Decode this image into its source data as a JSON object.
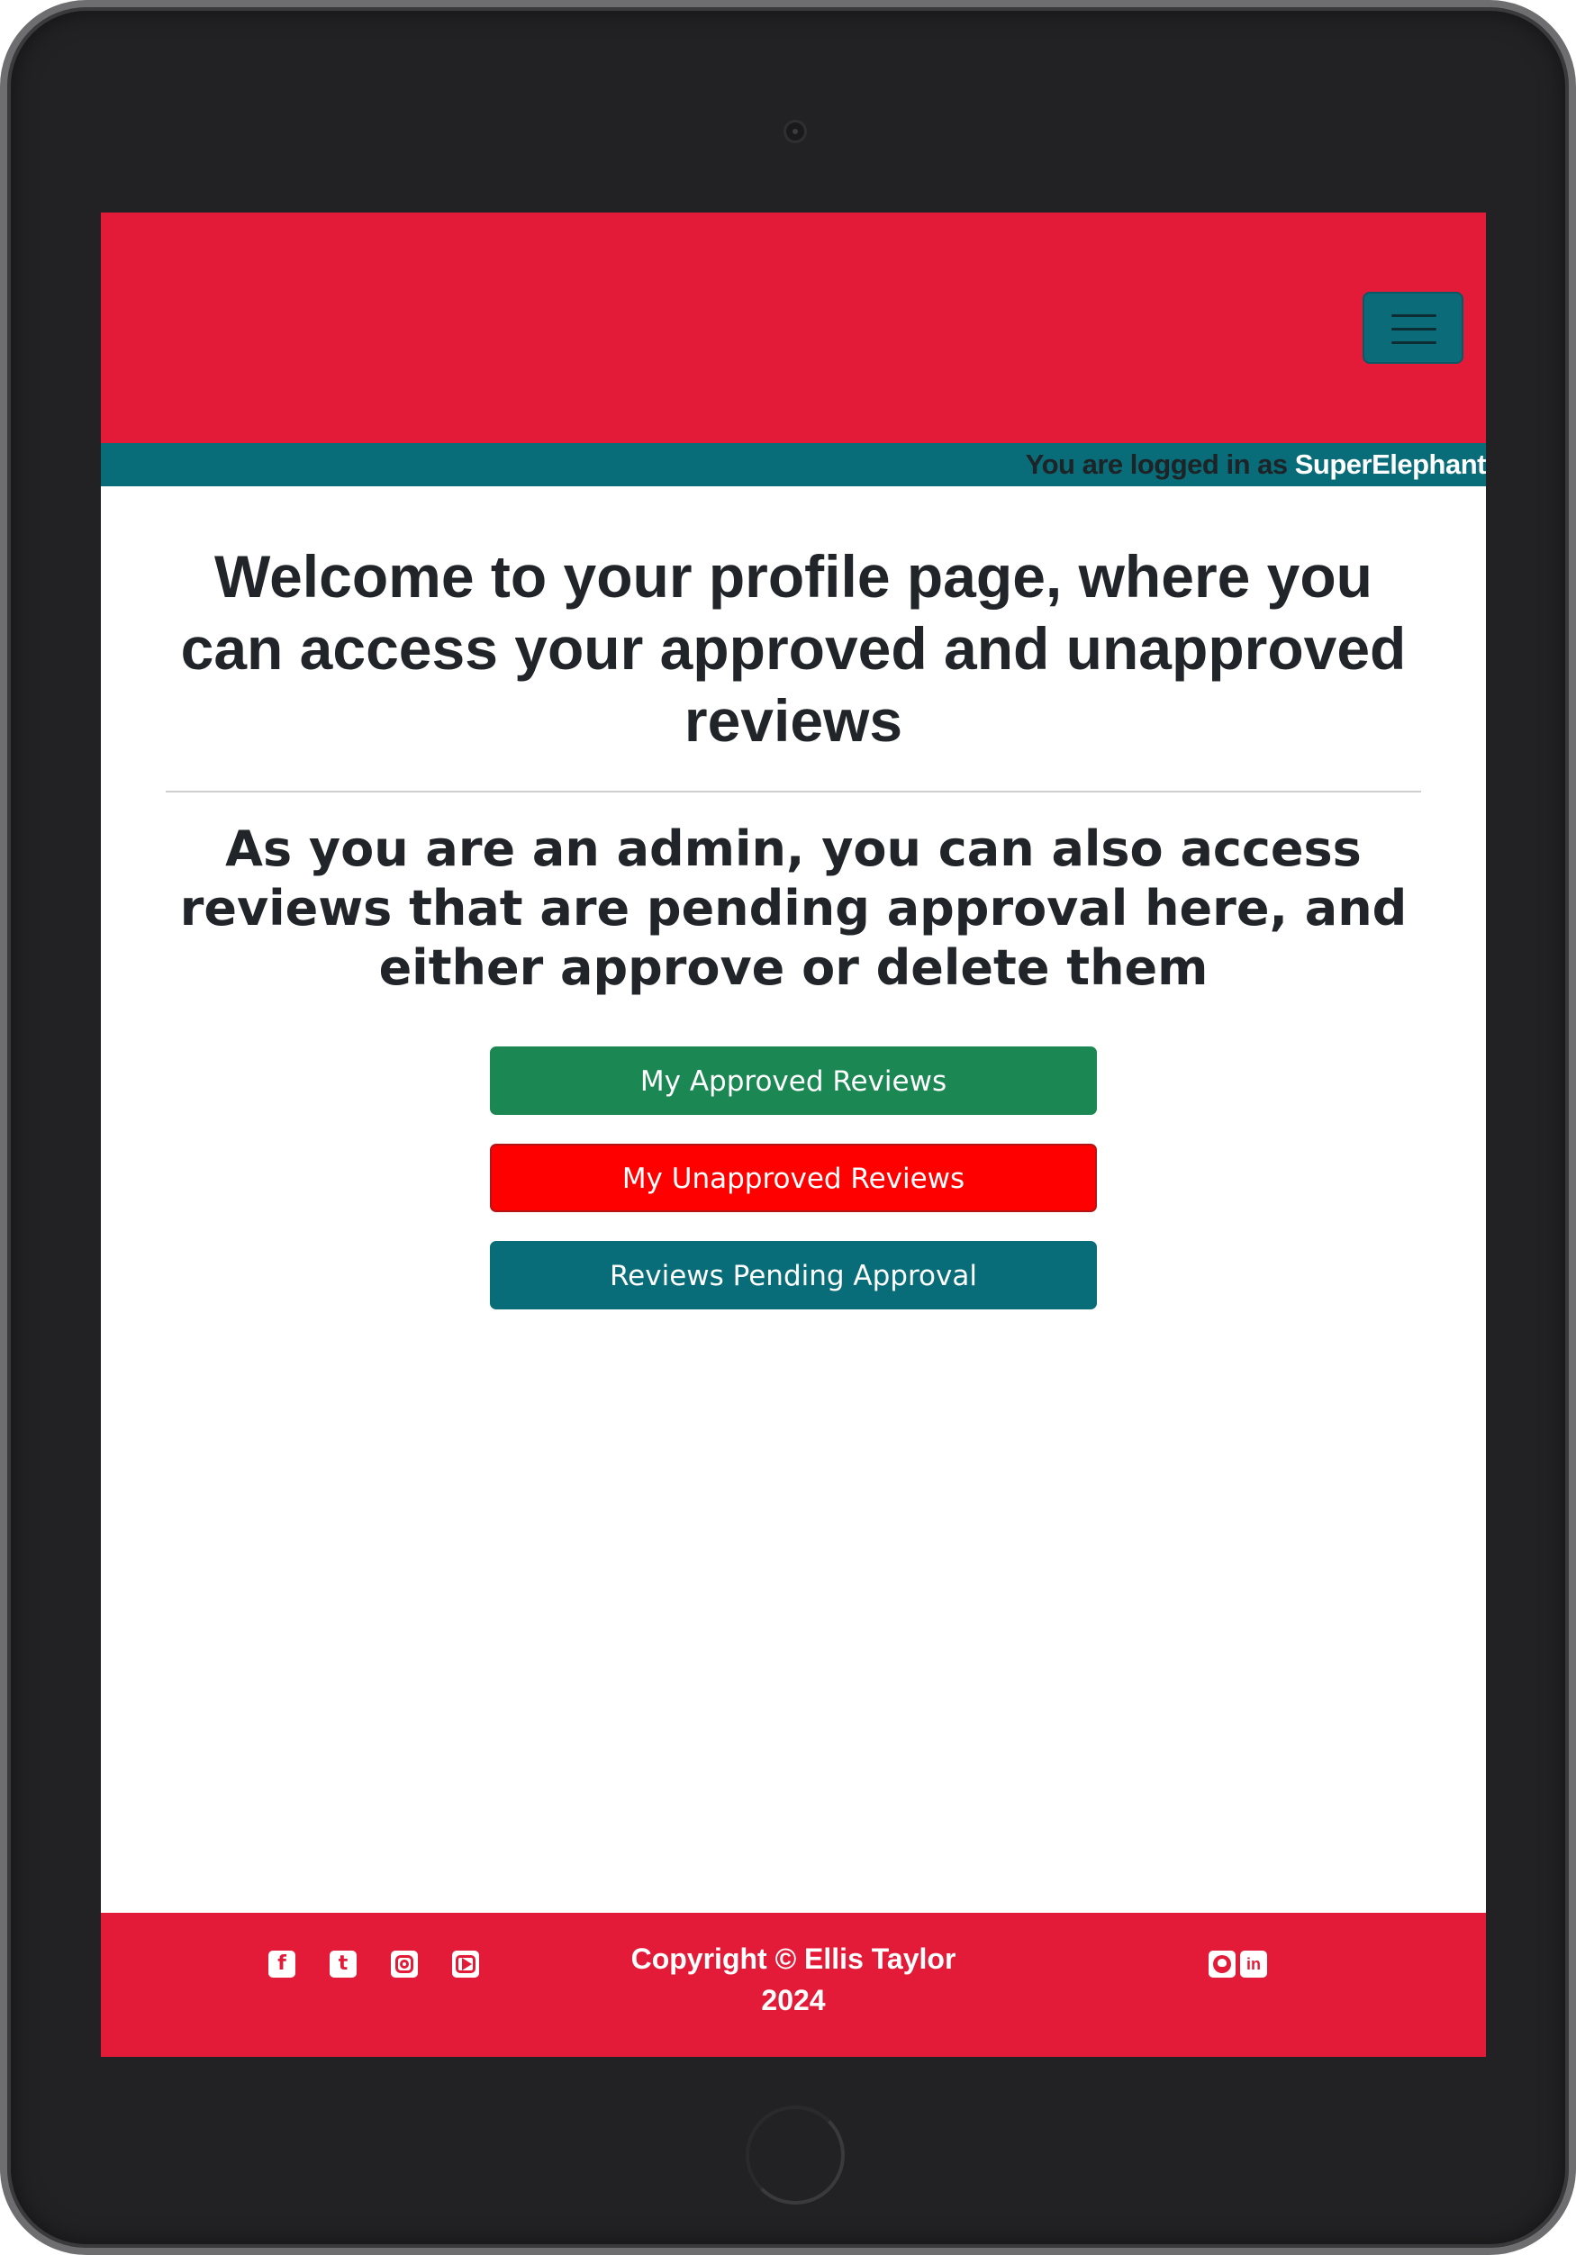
{
  "login_bar": {
    "prefix": "You are logged in as ",
    "username": "SuperElephant"
  },
  "main": {
    "welcome_heading": "Welcome to your profile page, where you can access your approved and unapproved reviews",
    "admin_note": "As you are an admin, you can also access reviews that are pending approval here, and either approve or delete them",
    "buttons": {
      "approved": "My Approved Reviews",
      "unapproved": "My Unapproved Reviews",
      "pending": "Reviews Pending Approval"
    }
  },
  "footer": {
    "copyright_line1": "Copyright © Ellis Taylor",
    "copyright_line2": "2024",
    "social_left": [
      "facebook-icon",
      "twitter-icon",
      "instagram-icon",
      "youtube-icon"
    ],
    "social_right": [
      "github-icon",
      "linkedin-icon"
    ]
  },
  "colors": {
    "brand_red": "#e41b38",
    "teal": "#086d78",
    "approved_green": "#1b8752",
    "unapproved_red": "#ff0000"
  }
}
